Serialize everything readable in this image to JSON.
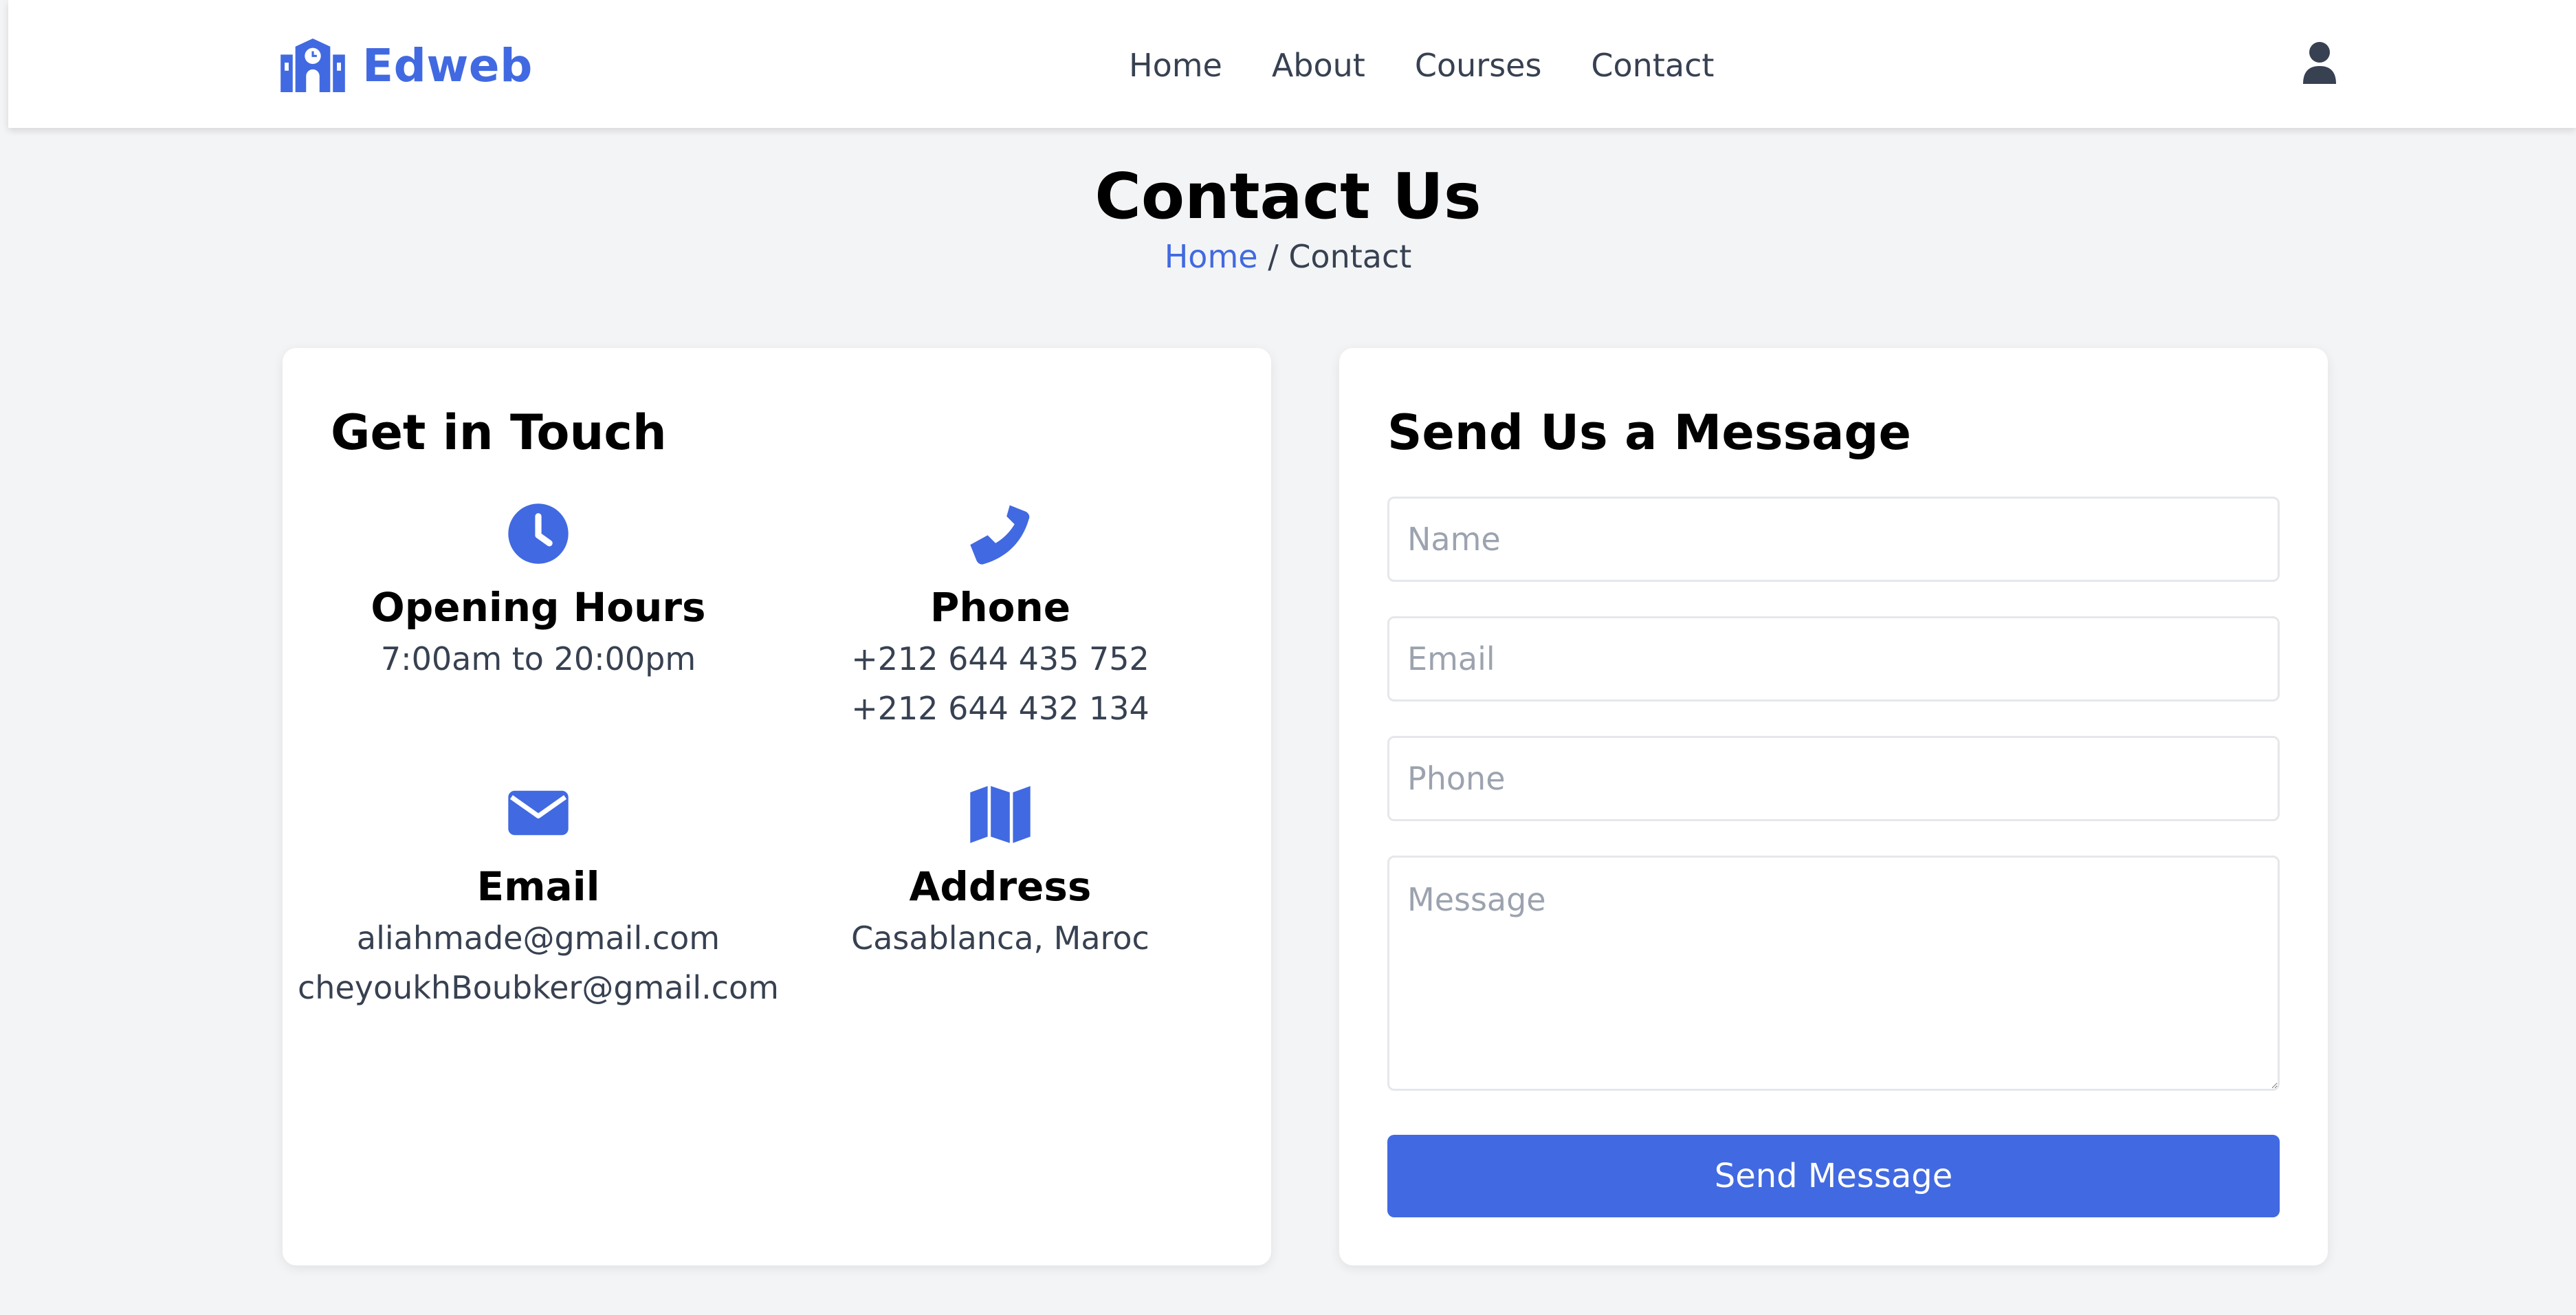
{
  "brand": {
    "name": "Edweb",
    "color": "#4169e1",
    "icon": "school-icon"
  },
  "nav": {
    "items": [
      "Home",
      "About",
      "Courses",
      "Contact"
    ]
  },
  "user": {
    "icon": "user-icon"
  },
  "page": {
    "title": "Contact Us",
    "breadcrumb": {
      "home": "Home",
      "separator": "/",
      "current": "Contact"
    }
  },
  "contact_info": {
    "heading": "Get in Touch",
    "opening_hours": {
      "icon": "clock-icon",
      "title": "Opening Hours",
      "lines": [
        "7:00am to 20:00pm"
      ]
    },
    "phone": {
      "icon": "phone-icon",
      "title": "Phone",
      "lines": [
        "+212 644 435 752",
        "+212 644 432 134"
      ]
    },
    "email": {
      "icon": "envelope-icon",
      "title": "Email",
      "lines": [
        "aliahmade@gmail.com",
        "cheyoukhBoubker@gmail.com"
      ]
    },
    "address": {
      "icon": "map-icon",
      "title": "Address",
      "lines": [
        "Casablanca, Maroc"
      ]
    }
  },
  "message_form": {
    "heading": "Send Us a Message",
    "name_placeholder": "Name",
    "email_placeholder": "Email",
    "phone_placeholder": "Phone",
    "message_placeholder": "Message",
    "submit_label": "Send Message"
  },
  "colors": {
    "accent": "#4169e1",
    "background": "#f3f4f6",
    "card": "#ffffff"
  }
}
